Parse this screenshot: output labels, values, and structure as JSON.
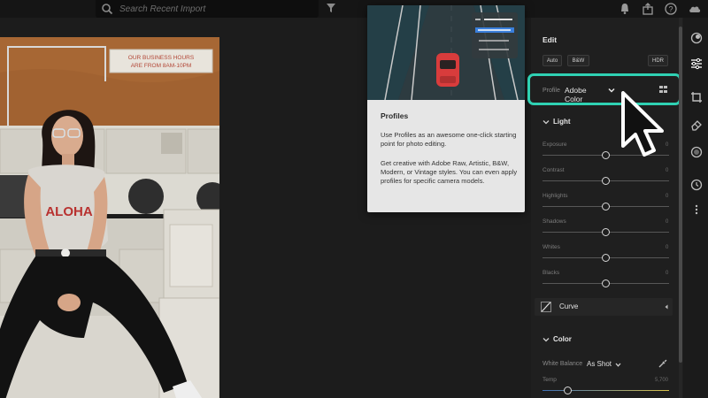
{
  "topbar": {
    "search_placeholder": "Search Recent Import",
    "icons": [
      "search-icon",
      "filter-icon",
      "bell-icon",
      "share-icon",
      "help-icon",
      "cloud-icon"
    ]
  },
  "popup": {
    "title": "Profiles",
    "paragraph1": "Use Profiles as an awesome one-click starting point for photo editing.",
    "paragraph2": "Get creative with Adobe Raw, Artistic, B&W, Modern, or Vintage styles. You can even apply profiles for specific camera models."
  },
  "photo": {
    "sign_line1": "OUR BUSINESS HOURS",
    "sign_line2": "ARE FROM 8AM-10PM",
    "shirt_text": "ALOHA"
  },
  "edit": {
    "title": "Edit",
    "auto_label": "Auto",
    "bw_label": "B&W",
    "hdr_label": "HDR",
    "profile_label": "Profile",
    "profile_value": "Adobe Color",
    "light": {
      "title": "Light",
      "sliders": [
        {
          "label": "Exposure",
          "value": "0",
          "position": 0.5
        },
        {
          "label": "Contrast",
          "value": "0",
          "position": 0.5
        },
        {
          "label": "Highlights",
          "value": "0",
          "position": 0.5
        },
        {
          "label": "Shadows",
          "value": "0",
          "position": 0.5
        },
        {
          "label": "Whites",
          "value": "0",
          "position": 0.5
        },
        {
          "label": "Blacks",
          "value": "0",
          "position": 0.5
        }
      ]
    },
    "curve_label": "Curve",
    "color": {
      "title": "Color",
      "wb_label": "White Balance",
      "wb_value": "As Shot",
      "temp_label": "Temp",
      "temp_value": "5,700",
      "temp_position": 0.2
    }
  },
  "colors": {
    "highlight_outline": "#2fd1b3",
    "panel_bg": "#1f1f1f",
    "popup_bg": "#e6e6e6"
  }
}
